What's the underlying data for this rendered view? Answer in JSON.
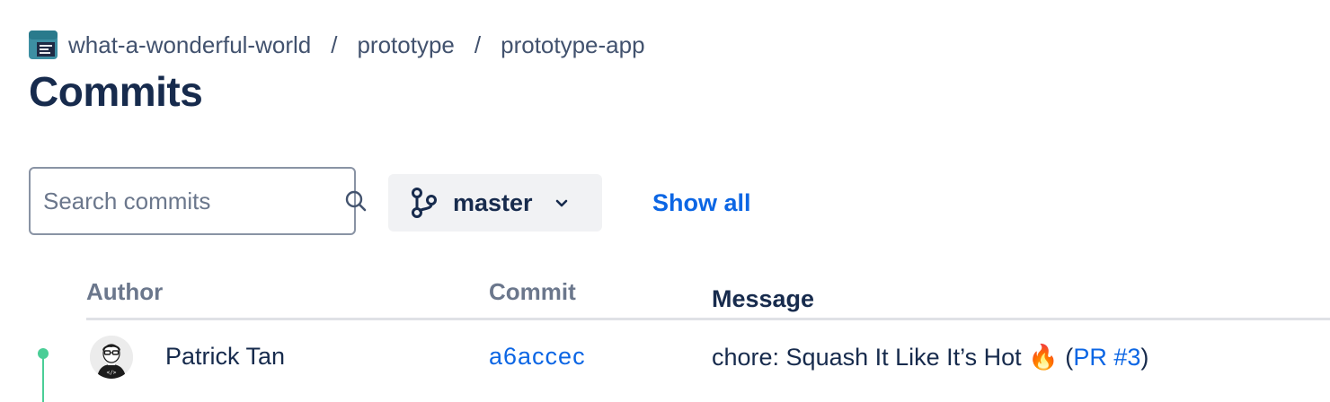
{
  "breadcrumb": {
    "project": "what-a-wonderful-world",
    "separator": "/",
    "workspace": "prototype",
    "repository": "prototype-app"
  },
  "page": {
    "title": "Commits"
  },
  "toolbar": {
    "search_placeholder": "Search commits",
    "search_value": "",
    "branch_label": "master",
    "show_all_label": "Show all"
  },
  "table": {
    "columns": {
      "author": "Author",
      "commit": "Commit",
      "message": "Message"
    },
    "rows": [
      {
        "author": "Patrick Tan",
        "commit": "a6accec",
        "message_text": "chore: Squash It Like It’s Hot 🔥 (",
        "pr_link": "PR #3",
        "message_close": ")"
      }
    ]
  },
  "icons": {
    "project": "project-board-icon",
    "search": "search-icon",
    "branch": "git-branch-icon",
    "chevron": "chevron-down-icon"
  },
  "colors": {
    "link": "#0c66e4",
    "timeline": "#4bce97",
    "heading": "#172b4d",
    "muted": "#6b778c",
    "project_icon": "#2a7a8c"
  }
}
